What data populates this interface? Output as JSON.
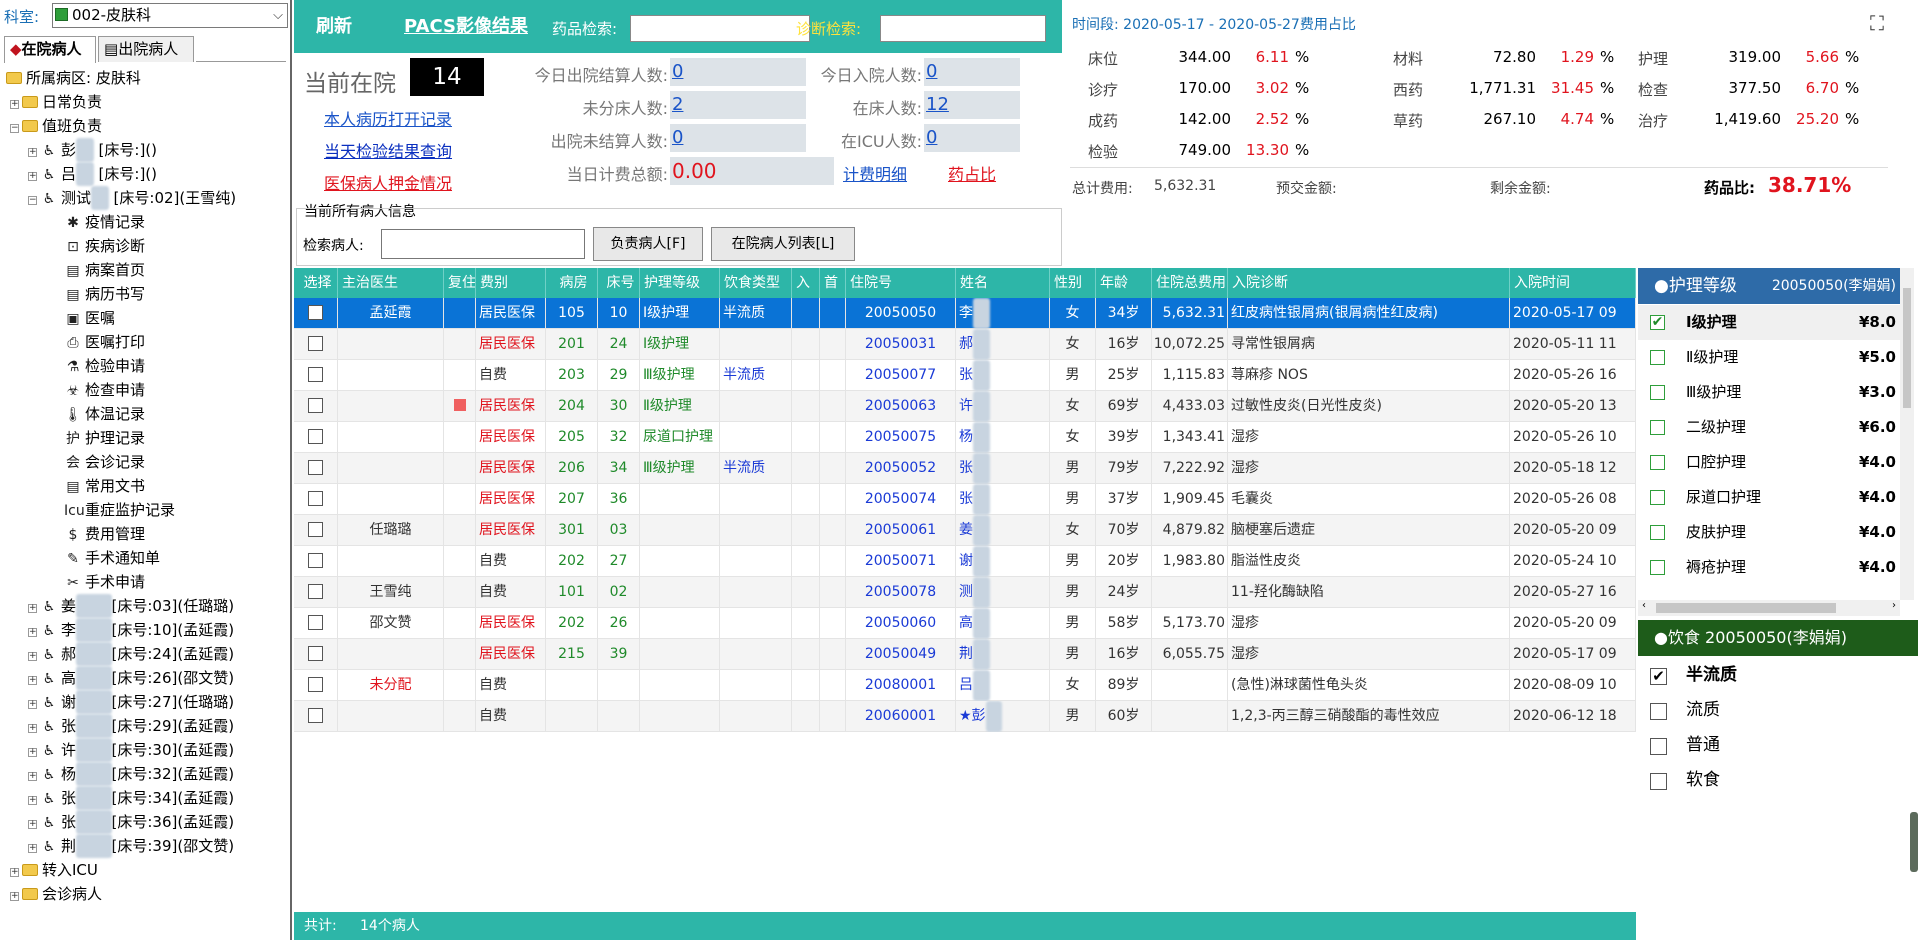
{
  "left": {
    "dept_label": "科室:",
    "dept_value": "002-皮肤科",
    "tabs": [
      "在院病人",
      "出院病人"
    ],
    "ward": "所属病区: 皮肤科",
    "groups": [
      "日常负责",
      "值班负责"
    ],
    "items": [
      {
        "pre": "彭",
        "post": " [床号:]()"
      },
      {
        "pre": "吕",
        "post": " [床号:]()"
      },
      {
        "pre": "测试",
        "post": " [床号:02](王雪纯)"
      }
    ],
    "menu": [
      "疫情记录",
      "疾病诊断",
      "病案首页",
      "病历书写",
      "医嘱",
      "医嘱打印",
      "检验申请",
      "检查申请",
      "体温记录",
      "护理记录",
      "会诊记录",
      "常用文书",
      "重症监护记录",
      "费用管理",
      "手术通知单",
      "手术申请"
    ],
    "menu_icons": [
      "virus-icon",
      "diagnosis-icon",
      "home-icon",
      "book-icon",
      "order-icon",
      "printer-icon",
      "flask-icon",
      "biohazard-icon",
      "thermometer-icon",
      "nursing-icon",
      "consult-icon",
      "document-icon",
      "icu-icon",
      "dollar-icon",
      "surgery-notice-icon",
      "surgery-tools-icon"
    ],
    "patients": [
      {
        "pre": "姜",
        "post": "[床号:03](任璐璐)"
      },
      {
        "pre": "李",
        "post": "[床号:10](孟延霞)"
      },
      {
        "pre": "郝",
        "post": "[床号:24](孟延霞)"
      },
      {
        "pre": "高",
        "post": "[床号:26](邵文赞)"
      },
      {
        "pre": "谢",
        "post": "[床号:27](任璐璐)"
      },
      {
        "pre": "张",
        "post": "[床号:29](孟延霞)"
      },
      {
        "pre": "许",
        "post": "[床号:30](孟延霞)"
      },
      {
        "pre": "杨",
        "post": "[床号:32](孟延霞)"
      },
      {
        "pre": "张",
        "post": "[床号:34](孟延霞)"
      },
      {
        "pre": "张",
        "post": "[床号:36](孟延霞)"
      },
      {
        "pre": "荆",
        "post": "[床号:39](邵文赞)"
      }
    ],
    "tail_groups": [
      "转入ICU",
      "会诊病人"
    ]
  },
  "topbar": {
    "refresh": "刷新",
    "pacs": "PACS影像结果",
    "drug_search_label": "药品检索:",
    "diag_search_label": "诊断检索:"
  },
  "stats": {
    "current_label": "当前在院",
    "current_value": "14",
    "links": [
      "本人病历打开记录",
      "当天检验结果查询",
      "医保病人押金情况"
    ],
    "today_discharge_label": "今日出院结算人数:",
    "today_discharge": "0",
    "unassigned_label": "未分床人数:",
    "unassigned": "2",
    "discharge_unsettled_label": "出院未结算人数:",
    "discharge_unsettled": "0",
    "today_fee_label": "当日计费总额:",
    "today_fee": "0.00",
    "today_admit_label": "今日入院人数:",
    "today_admit": "0",
    "inbed_label": "在床人数:",
    "inbed": "12",
    "icu_label": "在ICU人数:",
    "icu": "0",
    "fee_detail": "计费明细",
    "drug_ratio_link": "药占比"
  },
  "fees": {
    "period": "时间段:  2020-05-17 - 2020-05-27费用占比",
    "items": [
      {
        "name": "床位",
        "amt": "344.00",
        "pct": "6.11"
      },
      {
        "name": "材料",
        "amt": "72.80",
        "pct": "1.29"
      },
      {
        "name": "护理",
        "amt": "319.00",
        "pct": "5.66"
      },
      {
        "name": "诊疗",
        "amt": "170.00",
        "pct": "3.02"
      },
      {
        "name": "西药",
        "amt": "1,771.31",
        "pct": "31.45"
      },
      {
        "name": "检查",
        "amt": "377.50",
        "pct": "6.70"
      },
      {
        "name": "成药",
        "amt": "142.00",
        "pct": "2.52"
      },
      {
        "name": "草药",
        "amt": "267.10",
        "pct": "4.74"
      },
      {
        "name": "治疗",
        "amt": "1,419.60",
        "pct": "25.20"
      },
      {
        "name": "检验",
        "amt": "749.00",
        "pct": "13.30"
      }
    ],
    "pct_sign": "%",
    "total_label": "总计费用:",
    "total": "5,632.31",
    "prepaid_label": "预交金额:",
    "remain_label": "剩余金额:",
    "drug_ratio_label": "药品比:",
    "drug_ratio": "38.71%"
  },
  "search": {
    "title": "当前所有病人信息",
    "label": "检索病人:",
    "btn_mine": "负责病人[F]",
    "btn_list": "在院病人列表[L]"
  },
  "table": {
    "headers": [
      "选择",
      "主治医生",
      "复住",
      "费别",
      "病房",
      "床号",
      "护理等级",
      "饮食类型",
      "入",
      "首",
      "住院号",
      "姓名",
      "性别",
      "年龄",
      "住院总费用",
      "入院诊断",
      "入院时间"
    ],
    "rows": [
      {
        "doc": "孟延霞",
        "flag": "",
        "fee": "居民医保",
        "room": "105",
        "bed": "10",
        "nurse": "Ⅰ级护理",
        "diet": "半流质",
        "no": "20050050",
        "name": "李",
        "sex": "女",
        "age": "34岁",
        "total": "5,632.31",
        "diag": "红皮病性银屑病(银屑病性红皮病)",
        "time": "2020-05-17 09"
      },
      {
        "doc": "",
        "flag": "",
        "fee": "居民医保",
        "room": "201",
        "bed": "24",
        "nurse": "Ⅰ级护理",
        "diet": "",
        "no": "20050031",
        "name": "郝",
        "sex": "女",
        "age": "16岁",
        "total": "10,072.25",
        "diag": "寻常性银屑病",
        "time": "2020-05-11 11"
      },
      {
        "doc": "",
        "flag": "",
        "fee": "自费",
        "room": "203",
        "bed": "29",
        "nurse": "Ⅲ级护理",
        "diet": "半流质",
        "no": "20050077",
        "name": "张",
        "sex": "男",
        "age": "25岁",
        "total": "1,115.83",
        "diag": "荨麻疹 NOS",
        "time": "2020-05-26 16"
      },
      {
        "doc": "",
        "flag": "red",
        "fee": "居民医保",
        "room": "204",
        "bed": "30",
        "nurse": "Ⅱ级护理",
        "diet": "",
        "no": "20050063",
        "name": "许",
        "sex": "女",
        "age": "69岁",
        "total": "4,433.03",
        "diag": "过敏性皮炎(日光性皮炎)",
        "time": "2020-05-20 13"
      },
      {
        "doc": "",
        "flag": "",
        "fee": "居民医保",
        "room": "205",
        "bed": "32",
        "nurse": "尿道口护理",
        "diet": "",
        "no": "20050075",
        "name": "杨",
        "sex": "女",
        "age": "39岁",
        "total": "1,343.41",
        "diag": "湿疹",
        "time": "2020-05-26 10"
      },
      {
        "doc": "",
        "flag": "",
        "fee": "居民医保",
        "room": "206",
        "bed": "34",
        "nurse": "Ⅲ级护理",
        "diet": "半流质",
        "no": "20050052",
        "name": "张",
        "sex": "男",
        "age": "79岁",
        "total": "7,222.92",
        "diag": "湿疹",
        "time": "2020-05-18 12"
      },
      {
        "doc": "",
        "flag": "",
        "fee": "居民医保",
        "room": "207",
        "bed": "36",
        "nurse": "",
        "diet": "",
        "no": "20050074",
        "name": "张",
        "sex": "男",
        "age": "37岁",
        "total": "1,909.45",
        "diag": "毛囊炎",
        "time": "2020-05-26 08"
      },
      {
        "doc": "任璐璐",
        "flag": "",
        "fee": "居民医保",
        "room": "301",
        "bed": "03",
        "nurse": "",
        "diet": "",
        "no": "20050061",
        "name": "姜",
        "sex": "女",
        "age": "70岁",
        "total": "4,879.82",
        "diag": "脑梗塞后遗症",
        "time": "2020-05-20 09"
      },
      {
        "doc": "",
        "flag": "",
        "fee": "自费",
        "room": "202",
        "bed": "27",
        "nurse": "",
        "diet": "",
        "no": "20050071",
        "name": "谢",
        "sex": "男",
        "age": "20岁",
        "total": "1,983.80",
        "diag": "脂溢性皮炎",
        "time": "2020-05-24 10"
      },
      {
        "doc": "王雪纯",
        "flag": "",
        "fee": "自费",
        "room": "101",
        "bed": "02",
        "nurse": "",
        "diet": "",
        "no": "20050078",
        "name": "测",
        "sex": "男",
        "age": "24岁",
        "total": "",
        "diag": "11-羟化酶缺陷",
        "time": "2020-05-27 16"
      },
      {
        "doc": "邵文赞",
        "flag": "",
        "fee": "居民医保",
        "room": "202",
        "bed": "26",
        "nurse": "",
        "diet": "",
        "no": "20050060",
        "name": "高",
        "sex": "男",
        "age": "58岁",
        "total": "5,173.70",
        "diag": "湿疹",
        "time": "2020-05-20 09"
      },
      {
        "doc": "",
        "flag": "",
        "fee": "居民医保",
        "room": "215",
        "bed": "39",
        "nurse": "",
        "diet": "",
        "no": "20050049",
        "name": "荆",
        "sex": "男",
        "age": "16岁",
        "total": "6,055.75",
        "diag": "湿疹",
        "time": "2020-05-17 09"
      },
      {
        "doc": "未分配",
        "flag": "",
        "fee": "自费",
        "room": "",
        "bed": "",
        "nurse": "",
        "diet": "",
        "no": "20080001",
        "name": "吕",
        "sex": "女",
        "age": "89岁",
        "total": "",
        "diag": "(急性)淋球菌性龟头炎",
        "time": "2020-08-09 10"
      },
      {
        "doc": "",
        "flag": "",
        "fee": "自费",
        "room": "",
        "bed": "",
        "nurse": "",
        "diet": "",
        "no": "20060001",
        "name": "★彭",
        "sex": "男",
        "age": "60岁",
        "total": "",
        "diag": "1,2,3-丙三醇三硝酸酯的毒性效应",
        "time": "2020-06-12 18"
      }
    ],
    "footer_label": "共计:",
    "footer_value": "14个病人"
  },
  "nursing": {
    "title": "●护理等级",
    "who": "20050050(李娟娟)",
    "items": [
      {
        "name": "Ⅰ级护理",
        "price": "¥8.0",
        "checked": true
      },
      {
        "name": "Ⅱ级护理",
        "price": "¥5.0",
        "checked": false
      },
      {
        "name": "Ⅲ级护理",
        "price": "¥3.0",
        "checked": false
      },
      {
        "name": "二级护理",
        "price": "¥6.0",
        "checked": false
      },
      {
        "name": "口腔护理",
        "price": "¥4.0",
        "checked": false
      },
      {
        "name": "尿道口护理",
        "price": "¥4.0",
        "checked": false
      },
      {
        "name": "皮肤护理",
        "price": "¥4.0",
        "checked": false
      },
      {
        "name": "褥疮护理",
        "price": "¥4.0",
        "checked": false
      }
    ]
  },
  "diet": {
    "title": "●饮食 20050050(李娟娟)",
    "items": [
      {
        "name": "半流质",
        "checked": true
      },
      {
        "name": "流质",
        "checked": false
      },
      {
        "name": "普通",
        "checked": false
      },
      {
        "name": "软食",
        "checked": false
      }
    ]
  }
}
